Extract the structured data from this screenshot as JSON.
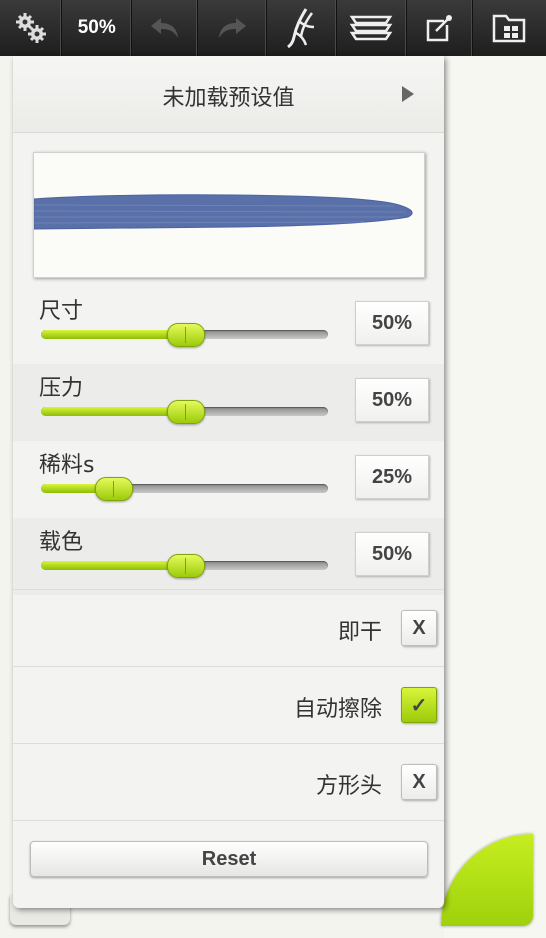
{
  "toolbar": {
    "zoom": "50%",
    "icons": [
      "settings-gears-icon",
      "undo-icon",
      "redo-icon",
      "brush-icon",
      "layers-icon",
      "share-icon",
      "gallery-icon"
    ]
  },
  "brush_panel": {
    "preset": "未加载预设值",
    "sliders": [
      {
        "label": "尺寸",
        "value": "50%",
        "level": 0.5
      },
      {
        "label": "压力",
        "value": "50%",
        "level": 0.5
      },
      {
        "label": "稀料s",
        "value": "25%",
        "level": 0.25
      },
      {
        "label": "载色",
        "value": "50%",
        "level": 0.5
      }
    ],
    "options": [
      {
        "label": "即干",
        "mark": "X",
        "checked": false
      },
      {
        "label": "自动擦除",
        "mark": "✓",
        "checked": true
      },
      {
        "label": "方形头",
        "mark": "X",
        "checked": false
      }
    ],
    "reset_label": "Reset"
  },
  "colors": {
    "accent": "#a8d815",
    "stroke": "#5a70a8"
  }
}
